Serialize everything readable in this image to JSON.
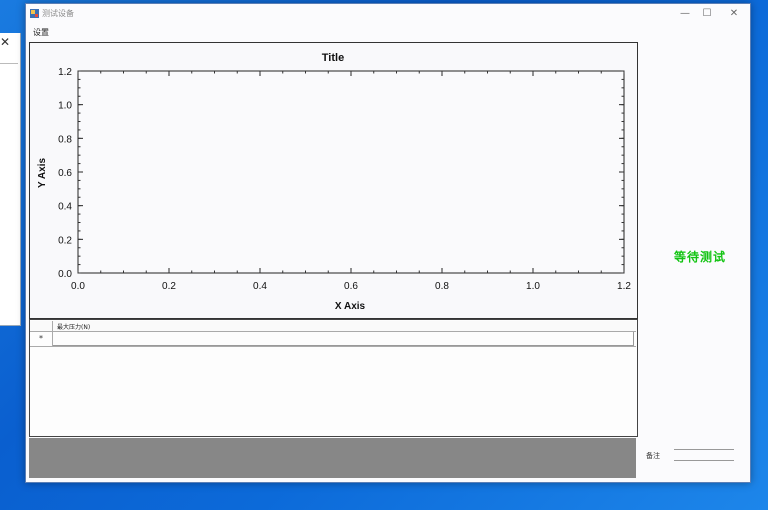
{
  "background_window": {
    "close_glyph": "✕"
  },
  "window": {
    "title": "测试设备",
    "minimize_glyph": "—",
    "maximize_glyph": "☐",
    "close_glyph": "✕"
  },
  "menu": {
    "settings": "设置"
  },
  "chart_data": {
    "type": "line",
    "title": "Title",
    "xlabel": "X Axis",
    "ylabel": "Y Axis",
    "xlim": [
      0,
      1.2
    ],
    "ylim": [
      0,
      1.2
    ],
    "x_ticks": [
      "0.0",
      "0.2",
      "0.4",
      "0.6",
      "0.8",
      "1.0",
      "1.2"
    ],
    "y_ticks": [
      "0.0",
      "0.2",
      "0.4",
      "0.6",
      "0.8",
      "1.0",
      "1.2"
    ],
    "series": [],
    "grid": false
  },
  "grid": {
    "columns": [
      "最大压力(N)"
    ],
    "new_row_marker": "*",
    "rows": []
  },
  "status": {
    "text": "等待测试",
    "color": "#12c412"
  },
  "remark": {
    "label": "备注"
  }
}
